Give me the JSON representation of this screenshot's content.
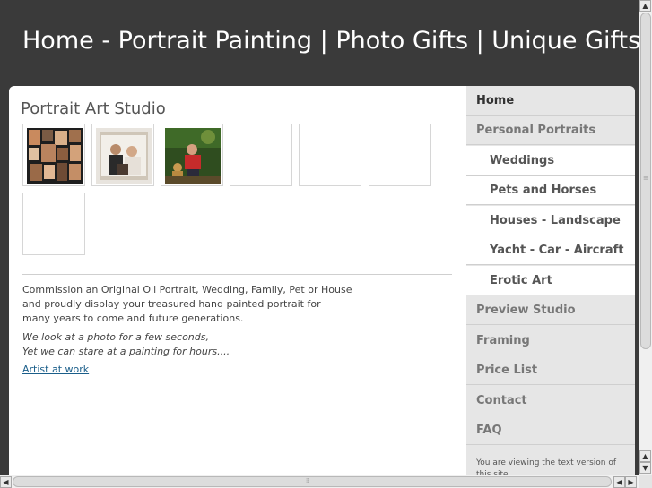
{
  "header": {
    "title": "Home - Portrait Painting | Photo Gifts | Unique Gifts"
  },
  "main": {
    "heading": "Portrait Art Studio",
    "thumbnails": [
      {
        "name": "collage-portraits"
      },
      {
        "name": "family-portrait"
      },
      {
        "name": "garden-portrait"
      },
      {
        "name": "empty"
      },
      {
        "name": "empty"
      },
      {
        "name": "empty"
      },
      {
        "name": "empty"
      }
    ],
    "para1_line1": "Commission an Original Oil Portrait, Wedding, Family, Pet or House",
    "para1_line2": "and proudly display your treasured hand painted portrait for",
    "para1_line3": "many years to come and future generations.",
    "quote_line1": "We look at a photo for a few seconds,",
    "quote_line2": "Yet we can stare at a painting for hours....",
    "link_text": "Artist at work"
  },
  "sidebar": {
    "items": [
      {
        "label": "Home",
        "type": "active"
      },
      {
        "label": "Personal Portraits",
        "type": "top"
      },
      {
        "label": "Weddings",
        "type": "sub"
      },
      {
        "label": "Pets and Horses",
        "type": "sub"
      },
      {
        "label": "Houses - Landscape",
        "type": "sub"
      },
      {
        "label": "Yacht - Car - Aircraft",
        "type": "sub"
      },
      {
        "label": "Erotic Art",
        "type": "sub"
      },
      {
        "label": "Preview Studio",
        "type": "top"
      },
      {
        "label": "Framing",
        "type": "top"
      },
      {
        "label": "Price List",
        "type": "top"
      },
      {
        "label": "Contact",
        "type": "top"
      },
      {
        "label": "FAQ",
        "type": "top"
      }
    ],
    "note": "You are viewing the text version of this site."
  },
  "scrollbars": {
    "up_icon": "arrow-up-icon",
    "down_icon": "arrow-down-icon",
    "left_icon": "arrow-left-icon",
    "right_icon": "arrow-right-icon"
  }
}
